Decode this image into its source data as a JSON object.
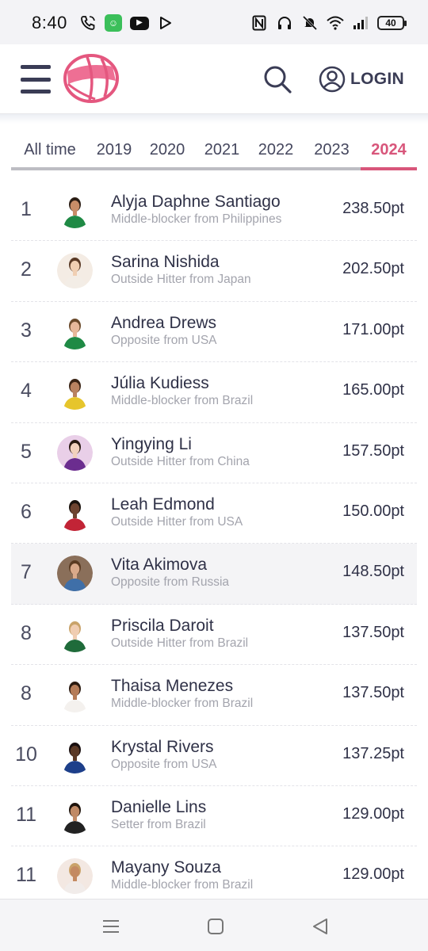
{
  "status_bar": {
    "time": "8:40",
    "battery": "40",
    "left_icons": [
      "phone-wifi-icon",
      "app-badge-icon",
      "youtube-icon",
      "play-store-icon"
    ],
    "right_icons": [
      "nfc-icon",
      "headphones-icon",
      "muted-bell-icon",
      "wifi-icon",
      "signal-icon",
      "battery-icon"
    ]
  },
  "header": {
    "login_label": "LOGIN",
    "brand_color": "#d8567b"
  },
  "tabs": [
    {
      "label": "All time",
      "active": false
    },
    {
      "label": "2019",
      "active": false
    },
    {
      "label": "2020",
      "active": false
    },
    {
      "label": "2021",
      "active": false
    },
    {
      "label": "2022",
      "active": false
    },
    {
      "label": "2023",
      "active": false
    },
    {
      "label": "2024",
      "active": true
    }
  ],
  "players": [
    {
      "rank": "1",
      "name": "Alyja Daphne Santiago",
      "desc": "Middle-blocker from Philippines",
      "points": "238.50pt"
    },
    {
      "rank": "2",
      "name": "Sarina Nishida",
      "desc": "Outside Hitter from Japan",
      "points": "202.50pt"
    },
    {
      "rank": "3",
      "name": "Andrea Drews",
      "desc": "Opposite from USA",
      "points": "171.00pt"
    },
    {
      "rank": "4",
      "name": "Júlia Kudiess",
      "desc": "Middle-blocker from Brazil",
      "points": "165.00pt"
    },
    {
      "rank": "5",
      "name": "Yingying Li",
      "desc": "Outside Hitter from China",
      "points": "157.50pt"
    },
    {
      "rank": "6",
      "name": "Leah Edmond",
      "desc": "Outside Hitter from USA",
      "points": "150.00pt"
    },
    {
      "rank": "7",
      "name": "Vita Akimova",
      "desc": "Opposite from Russia",
      "points": "148.50pt"
    },
    {
      "rank": "8",
      "name": "Priscila Daroit",
      "desc": "Outside Hitter from Brazil",
      "points": "137.50pt"
    },
    {
      "rank": "8",
      "name": "Thaisa Menezes",
      "desc": "Middle-blocker from Brazil",
      "points": "137.50pt"
    },
    {
      "rank": "10",
      "name": "Krystal Rivers",
      "desc": "Opposite from USA",
      "points": "137.25pt"
    },
    {
      "rank": "11",
      "name": "Danielle Lins",
      "desc": "Setter from Brazil",
      "points": "129.00pt"
    },
    {
      "rank": "11",
      "name": "Mayany Souza",
      "desc": "Middle-blocker from Brazil",
      "points": "129.00pt"
    }
  ],
  "avatar_styles": [
    {
      "skin": "#c98d68",
      "hair": "#2b1d14",
      "shirt": "#1f8a45",
      "bg": "#ffffff"
    },
    {
      "skin": "#f0cfb3",
      "hair": "#5a3a26",
      "shirt": "#f3ede6",
      "bg": "#f4ece4"
    },
    {
      "skin": "#e7b89a",
      "hair": "#6b4a2b",
      "shirt": "#1f8a45",
      "bg": "#ffffff"
    },
    {
      "skin": "#b98260",
      "hair": "#3b2415",
      "shirt": "#e6c52c",
      "bg": "#ffffff"
    },
    {
      "skin": "#f2d1bd",
      "hair": "#2a1a12",
      "shirt": "#6b2d8f",
      "bg": "#e9cfe8"
    },
    {
      "skin": "#6e4430",
      "hair": "#1a120c",
      "shirt": "#c22436",
      "bg": "#ffffff"
    },
    {
      "skin": "#d9a98a",
      "hair": "#5b3b22",
      "shirt": "#3f6fa8",
      "bg": "#8a6f5a"
    },
    {
      "skin": "#f0cdb2",
      "hair": "#c9a36a",
      "shirt": "#1f6b3a",
      "bg": "#ffffff"
    },
    {
      "skin": "#b57c58",
      "hair": "#2a1a10",
      "shirt": "#f4f1ee",
      "bg": "#ffffff"
    },
    {
      "skin": "#5c3a26",
      "hair": "#1a1010",
      "shirt": "#1d3f8a",
      "bg": "#ffffff"
    },
    {
      "skin": "#c08a66",
      "hair": "#1f140d",
      "shirt": "#222222",
      "bg": "#ffffff"
    },
    {
      "skin": "#c48a62",
      "hair": "#caa36a",
      "shirt": "#f1ecea",
      "bg": "#f3e8e2"
    }
  ],
  "nav_bar": {
    "icons": [
      "recents-icon",
      "home-icon",
      "back-icon"
    ]
  }
}
